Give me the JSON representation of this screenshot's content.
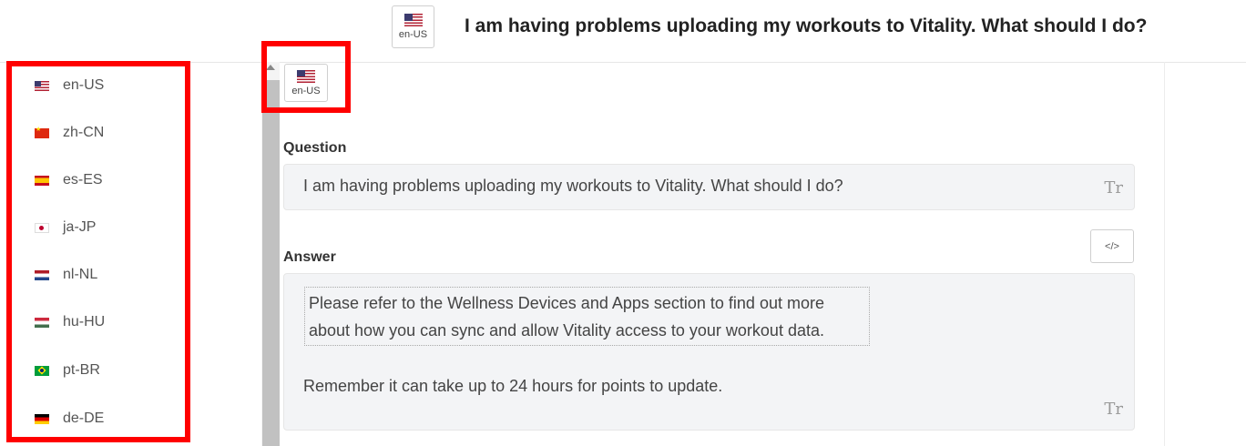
{
  "header": {
    "locale_code": "en-US",
    "title": "I am having problems uploading my workouts to Vitality. What should I do?"
  },
  "sidebar": {
    "languages": [
      {
        "code": "en-US",
        "flag": "us-flag-icon"
      },
      {
        "code": "zh-CN",
        "flag": "cn-flag-icon"
      },
      {
        "code": "es-ES",
        "flag": "es-flag-icon"
      },
      {
        "code": "ja-JP",
        "flag": "jp-flag-icon"
      },
      {
        "code": "nl-NL",
        "flag": "nl-flag-icon"
      },
      {
        "code": "hu-HU",
        "flag": "hu-flag-icon"
      },
      {
        "code": "pt-BR",
        "flag": "br-flag-icon"
      },
      {
        "code": "de-DE",
        "flag": "de-flag-icon"
      }
    ]
  },
  "main": {
    "locale_code": "en-US",
    "question_label": "Question",
    "question_value": "I am having problems uploading my workouts to Vitality. What should I do?",
    "answer_label": "Answer",
    "answer_block": "Please refer to the Wellness Devices and Apps section to find out more about how you can sync and allow Vitality access to your workout data.",
    "answer_line": "Remember it can take up to 24 hours for points to update.",
    "text_format_icon": "Tr",
    "code_view_icon": "</>"
  },
  "colors": {
    "highlight": "#ff0000",
    "field_background": "#f3f4f6"
  }
}
